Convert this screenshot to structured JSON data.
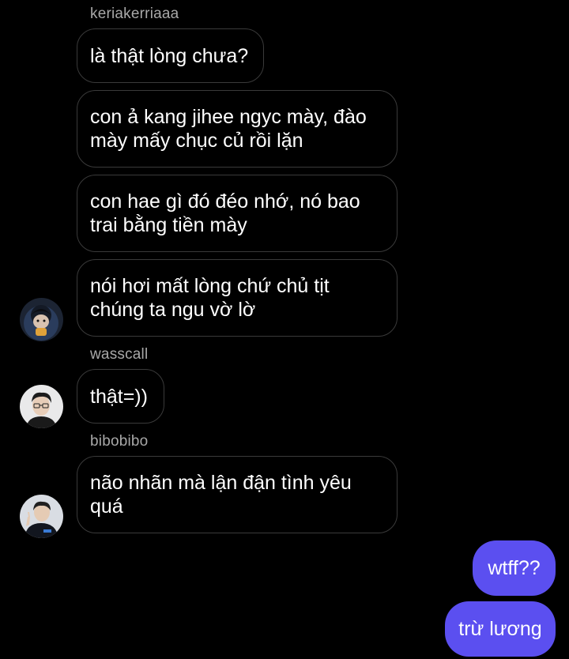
{
  "colors": {
    "background": "#000000",
    "incoming_border": "#3a3a3a",
    "outgoing_bubble": "#5b4ff0",
    "sender_name": "#a8a8a8"
  },
  "messages": {
    "group1": {
      "sender": "keriakerriaaa",
      "m1": "là thật lòng chưa?",
      "m2": "con ả kang jihee ngyc mày, đào mày mấy chục củ rồi lặn",
      "m3": "con hae gì đó đéo nhớ, nó bao trai bằng tiền mày",
      "m4": "nói hơi mất lòng chứ chủ tịt chúng ta ngu vờ lờ",
      "avatar_icon": "user-avatar-icon"
    },
    "group2": {
      "sender": "wasscall",
      "m1": "thật=))",
      "avatar_icon": "user-avatar-icon"
    },
    "group3": {
      "sender": "bibobibo",
      "m1": "não nhãn mà lận đận tình yêu quá",
      "avatar_icon": "user-avatar-icon"
    },
    "outgoing": {
      "m1": "wtff??",
      "m2": "trừ lương"
    }
  }
}
